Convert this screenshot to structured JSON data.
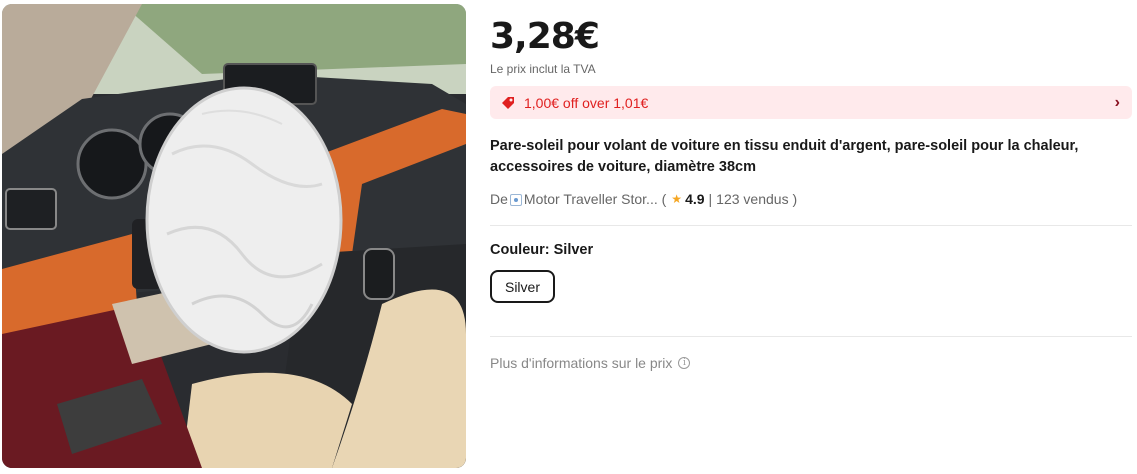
{
  "product": {
    "price": "3,28€",
    "vat_note": "Le prix inclut la TVA",
    "coupon": {
      "text": "1,00€ off over 1,01€",
      "icon": "coupon-tag-icon",
      "accent": "#e02020",
      "background": "#ffeaec"
    },
    "title": "Pare-soleil pour volant de voiture en tissu enduit d'argent, pare-soleil pour la chaleur, accessoires de voiture, diamètre 38cm",
    "store": {
      "prefix": "De",
      "name": "Motor Traveller Stor...",
      "rating": "4.9",
      "sold": "123 vendus"
    },
    "color": {
      "label": "Couleur: Silver",
      "options": [
        "Silver"
      ],
      "selected": "Silver"
    },
    "more_info": "Plus d'informations sur le prix"
  }
}
